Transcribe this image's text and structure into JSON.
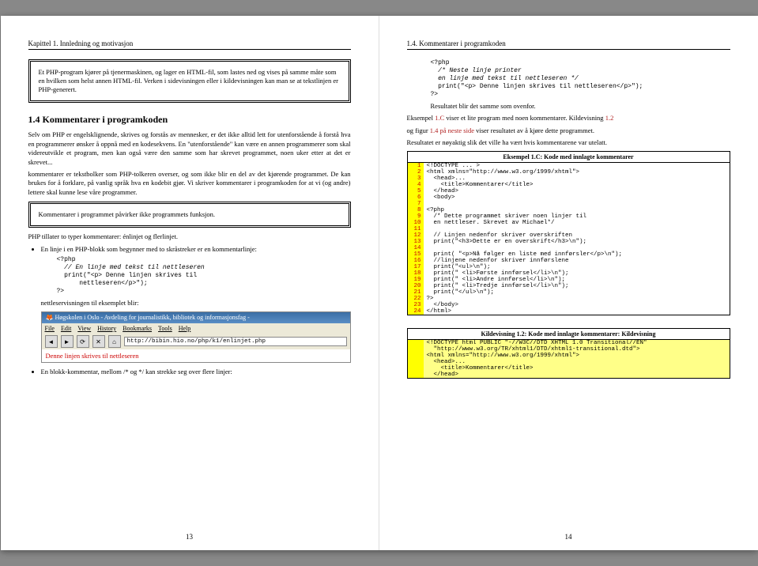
{
  "left": {
    "runhead": "Kapittel 1. Innledning og motivasjon",
    "box1": "Et PHP-program kjører på tjenermaskinen, og lager en HTML-fil, som lastes ned og vises på samme måte som en hvilken som helst annen HTML-fil. Verken i sidevisningen eller i kildevisningen kan man se at tekstlinjen er PHP-generert.",
    "sect": "1.4   Kommentarer i programkoden",
    "p1": "Selv om PHP er engelsklignende, skrives og forstås av mennesker, er det ikke alltid lett for utenforstående å forstå hva en programmerer ønsker å oppnå med en kodesekvens. En \"utenforstående\" kan være en annen programmerer som skal videreutvikle et program, men kan også være den samme som har skrevet programmet, noen uker etter at det er skrevet...",
    "p2": "kommentarer er tekstbolker som PHP-tolkeren overser, og som ikke blir en del av det kjørende programmet. De kan brukes for å forklare, på vanlig språk hva en kodebit gjør. Vi skriver kommentarer i programkoden for at vi (og andre) lettere skal kunne lese våre programmer.",
    "box2": "Kommentarer i programmet påvirker ikke programmets funksjon.",
    "p3": "PHP tillater to typer kommentarer: énlinjet og flerlinjet.",
    "li1": "En linje i en PHP-blokk som begynner med to skråstreker er en kommentarlinje:",
    "code1a": "<?php",
    "code1b": "  // En linje med tekst til nettleseren",
    "code1c": "  print(\"<p> Denne linjen skrives til\n      nettleseren</p>\");",
    "code1d": "?>",
    "p4": "nettleservisningen til eksemplet blir:",
    "btitle": "Høgskolen i Oslo - Avdeling for journalistikk, bibliotek og informasjonsfag - ",
    "bm1": "File",
    "bm2": "Edit",
    "bm3": "View",
    "bm4": "History",
    "bm5": "Bookmarks",
    "bm6": "Tools",
    "bm7": "Help",
    "burl": "http://bibin.hio.no/php/k1/enlinjet.php",
    "bbody": "Denne linjen skrives til nettleseren",
    "li2": "En blokk-kommentar, mellom /* og */ kan strekke seg over flere linjer:",
    "pagenum": "13"
  },
  "right": {
    "runhead": "1.4. Kommentarer i programkoden",
    "code2a": "<?php",
    "code2b": "  /* Neste linje printer",
    "code2c": "  en linje med tekst til nettleseren */",
    "code2d": "  print(\"<p> Denne linjen skrives til nettleseren</p>\");",
    "code2e": "?>",
    "p1": "Resultatet blir det samme som ovenfor.",
    "p2a": "Eksempel ",
    "p2b": "1.C",
    "p2c": " viser et lite program med noen kommentarer. Kildevisning ",
    "p2d": "1.2",
    "p3a": "og figur ",
    "p3b": "1.4 på neste side",
    "p3c": " viser resultatet av å kjøre dette programmet.",
    "p4": "Resultatet er nøyaktig slik det ville ha vært hvis kommentarene var utelatt.",
    "cap1": "Eksempel 1.C: Kode med innlagte kommentarer",
    "code3": [
      "<!DOCTYPE ... >",
      "<html xmlns=\"http://www.w3.org/1999/xhtml\">",
      "  <head>...",
      "    <title>Kommentarer</title>",
      "  </head>",
      "  <body>",
      "",
      "<?php",
      "  /* Dette programmet skriver noen linjer til",
      "  en nettleser. Skrevet av Michael*/",
      "",
      "  // Linjen nedenfor skriver overskriften",
      "  print(\"<h3>Dette er en overskrift</h3>\\n\");",
      "",
      "  print( \"<p>Nå følger en liste med innførsler</p>\\n\");",
      "  //linjene nedenfor skriver innførslene",
      "  print(\"<ul>\\n\");",
      "  print(\" <li>Første innførsel</li>\\n\");",
      "  print(\" <li>Andre innførsel</li>\\n\");",
      "  print(\" <li>Tredje innførsel</li>\\n\");",
      "  print(\"</ul>\\n\");",
      "?>",
      "  </body>",
      "</html>"
    ],
    "cap2": "Kildevisning 1.2: Kode med innlagte kommentarer: Kildevisning",
    "code4": [
      "<!DOCTYPE html PUBLIC \"-//W3C//DTD XHTML 1.0 Transitional//EN\"",
      "  \"http://www.w3.org/TR/xhtml1/DTD/xhtml1-transitional.dtd\">",
      "",
      "<html xmlns=\"http://www.w3.org/1999/xhtml\">",
      "  <head>...",
      "    <title>Kommentarer</title>",
      "  </head>"
    ],
    "pagenum": "14"
  }
}
